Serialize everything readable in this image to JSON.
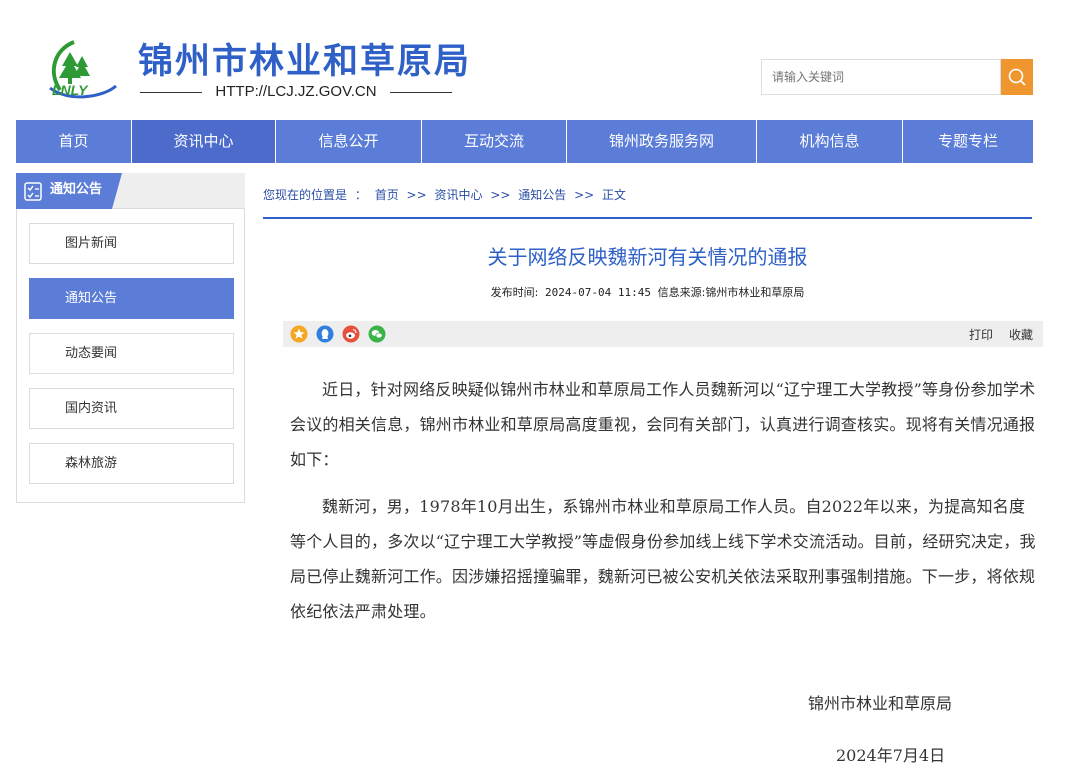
{
  "header": {
    "logo_text": "LNLY",
    "title": "锦州市林业和草原局",
    "url": "HTTP://LCJ.JZ.GOV.CN",
    "search_placeholder": "请输入关键词",
    "search_icon": "search-icon",
    "accent_color": "#f0962f"
  },
  "nav": {
    "items": [
      "首页",
      "资讯中心",
      "信息公开",
      "互动交流",
      "锦州政务服务网",
      "机构信息",
      "专题专栏"
    ],
    "active": "资讯中心",
    "color": "#5b7dd8"
  },
  "sidebar": {
    "title": "通知公告",
    "items": [
      "图片新闻",
      "通知公告",
      "动态要闻",
      "国内资讯",
      "森林旅游"
    ],
    "active": "通知公告"
  },
  "breadcrumb": {
    "prefix": "您现在的位置是",
    "sep": "：",
    "items": [
      "首页",
      "资讯中心",
      "通知公告",
      "正文"
    ],
    "arrow": ">>"
  },
  "article": {
    "title": "关于网络反映魏新河有关情况的通报",
    "publish_label": "发布时间:",
    "publish_time": "2024-07-04 11:45",
    "source_label": "信息来源:",
    "source": "锦州市林业和草原局",
    "print_label": "打印",
    "favorite_label": "收藏",
    "share_icons": [
      "qzone-icon",
      "qq-icon",
      "weibo-icon",
      "wechat-icon"
    ],
    "paragraphs": [
      "近日，针对网络反映疑似锦州市林业和草原局工作人员魏新河以“辽宁理工大学教授”等身份参加学术会议的相关信息，锦州市林业和草原局高度重视，会同有关部门，认真进行调查核实。现将有关情况通报如下：",
      "魏新河，男，1978年10月出生，系锦州市林业和草原局工作人员。自2022年以来，为提高知名度等个人目的，多次以“辽宁理工大学教授”等虚假身份参加线上线下学术交流活动。目前，经研究决定，我局已停止魏新河工作。因涉嫌招摇撞骗罪，魏新河已被公安机关依法采取刑事强制措施。下一步，将依规依纪依法严肃处理。"
    ],
    "sign_org": "锦州市林业和草原局",
    "sign_date": "2024年7月4日"
  }
}
